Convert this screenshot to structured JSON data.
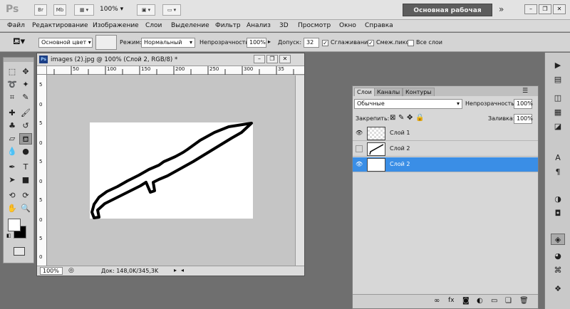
{
  "app": {
    "logo": "Ps",
    "zoom": "100%",
    "workspace": "Основная рабочая среда",
    "bridge_label": "Br",
    "mini_label": "Mb"
  },
  "menu": [
    "Файл",
    "Редактирование",
    "Изображение",
    "Слои",
    "Выделение",
    "Фильтр",
    "Анализ",
    "3D",
    "Просмотр",
    "Окно",
    "Справка"
  ],
  "options": {
    "fill_source": "Основной цвет",
    "mode_label": "Режим:",
    "mode_value": "Нормальный",
    "opacity_label": "Непрозрачность:",
    "opacity_value": "100%",
    "tolerance_label": "Допуск:",
    "tolerance_value": "32",
    "antialias_label": "Сглаживание",
    "contiguous_label": "Смеж.пикс",
    "all_layers_label": "Все слои"
  },
  "document": {
    "tab_title": "images (2).jpg @ 100% (Слой 2, RGB/8) *",
    "zoom": "100%",
    "doc_size": "Док: 148,0K/345,3K",
    "ruler_ticks": [
      "50",
      "100",
      "150",
      "200",
      "250",
      "300",
      "35"
    ],
    "ruler_left_ticks": [
      "5",
      "0",
      "5",
      "0",
      "5",
      "0",
      "5",
      "0",
      "5",
      "0"
    ]
  },
  "layers_panel": {
    "tabs": [
      "Слои",
      "Каналы",
      "Контуры"
    ],
    "blend_mode": "Обычные",
    "opacity_label": "Непрозрачность:",
    "opacity_value": "100%",
    "lock_label": "Закрепить:",
    "fill_label": "Заливка:",
    "fill_value": "100%",
    "layers": [
      {
        "name": "Слой 1",
        "visible": true,
        "selected": false
      },
      {
        "name": "Слой 2",
        "visible": false,
        "selected": false
      },
      {
        "name": "Слой 2",
        "visible": true,
        "selected": true
      }
    ]
  },
  "colors": {
    "selection": "#3a8ee6",
    "workspace_bg": "#6f6f6f",
    "ws_button": "#5d5d5d"
  }
}
